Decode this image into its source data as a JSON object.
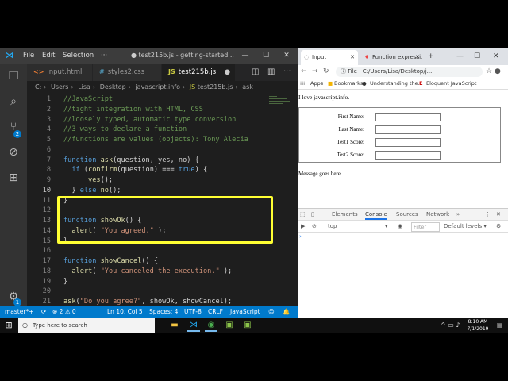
{
  "vscode": {
    "menu": [
      "File",
      "Edit",
      "Selection",
      "···"
    ],
    "window_title": "● test215b.js - getting-started...",
    "tabs": [
      {
        "icon": "<>",
        "label": "input.html"
      },
      {
        "icon": "#",
        "label": "styles2.css"
      },
      {
        "icon": "JS",
        "label": "test215b.js"
      }
    ],
    "breadcrumb": [
      "C:",
      "Users",
      "Lisa",
      "Desktop",
      "javascript.info",
      "test215b.js",
      "ask"
    ],
    "code_lines": [
      {
        "n": "1",
        "text": "//JavaScript",
        "kind": "com"
      },
      {
        "n": "2",
        "text": "//tight integration with HTML, CSS",
        "kind": "com"
      },
      {
        "n": "3",
        "text": "//loosely typed, automatic type conversion",
        "kind": "com"
      },
      {
        "n": "4",
        "text": "//3 ways to declare a function",
        "kind": "com"
      },
      {
        "n": "5",
        "text": "//functions are values (objects): Tony Alecia",
        "kind": "com"
      },
      {
        "n": "6",
        "text": "",
        "kind": "plain"
      },
      {
        "n": "7",
        "text": "function ask(question, yes, no) {",
        "kind": "plain"
      },
      {
        "n": "8",
        "text": "  if (confirm(question) === true) {",
        "kind": "plain"
      },
      {
        "n": "9",
        "text": "      yes();",
        "kind": "plain"
      },
      {
        "n": "10",
        "text": "  } else no();",
        "kind": "plain"
      },
      {
        "n": "11",
        "text": "}",
        "kind": "plain"
      },
      {
        "n": "12",
        "text": "",
        "kind": "plain"
      },
      {
        "n": "13",
        "text": "function showOk() {",
        "kind": "plain"
      },
      {
        "n": "14",
        "text": "  alert( \"You agreed.\" );",
        "kind": "plain"
      },
      {
        "n": "15",
        "text": "}",
        "kind": "plain"
      },
      {
        "n": "16",
        "text": "",
        "kind": "plain"
      },
      {
        "n": "17",
        "text": "function showCancel() {",
        "kind": "plain"
      },
      {
        "n": "18",
        "text": "  alert( \"You canceled the execution.\" );",
        "kind": "plain"
      },
      {
        "n": "19",
        "text": "}",
        "kind": "plain"
      },
      {
        "n": "20",
        "text": "",
        "kind": "plain"
      },
      {
        "n": "21",
        "text": "ask(\"Do you agree?\", showOk, showCancel);",
        "kind": "plain"
      }
    ],
    "status": {
      "branch": "master*+",
      "sync": "⟳",
      "problems": "⊗ 2 ⚠ 0",
      "position": "Ln 10, Col 5",
      "spaces": "Spaces: 4",
      "encoding": "UTF-8",
      "eol": "CRLF",
      "language": "JavaScript"
    },
    "badges": {
      "scm": "2",
      "ext": "1"
    }
  },
  "chrome": {
    "tabs": [
      {
        "label": "Input"
      },
      {
        "label": "Function expressi..."
      }
    ],
    "address": "C:/Users/Lisa/Desktop/j...",
    "address_prefix": "File",
    "bookmarks": [
      "Apps",
      "Bookmarks",
      "Understanding the...",
      "Eloquent JavaScript"
    ],
    "page": {
      "intro": "I love javascript.info.",
      "fields": [
        "First Name:",
        "Last Name:",
        "Test1 Score:",
        "Test2 Score:"
      ],
      "message": "Message goes here."
    },
    "devtools": {
      "tabs": [
        "Elements",
        "Console",
        "Sources",
        "Network",
        "»"
      ],
      "context": "top",
      "filter_placeholder": "Filter",
      "levels": "Default levels ▾",
      "prompt": "›"
    }
  },
  "taskbar": {
    "search_placeholder": "Type here to search",
    "time": "8:10 AM",
    "date": "7/1/2019"
  },
  "colors": {
    "vscode_accent": "#007acc",
    "highlight": "#ffff33"
  }
}
